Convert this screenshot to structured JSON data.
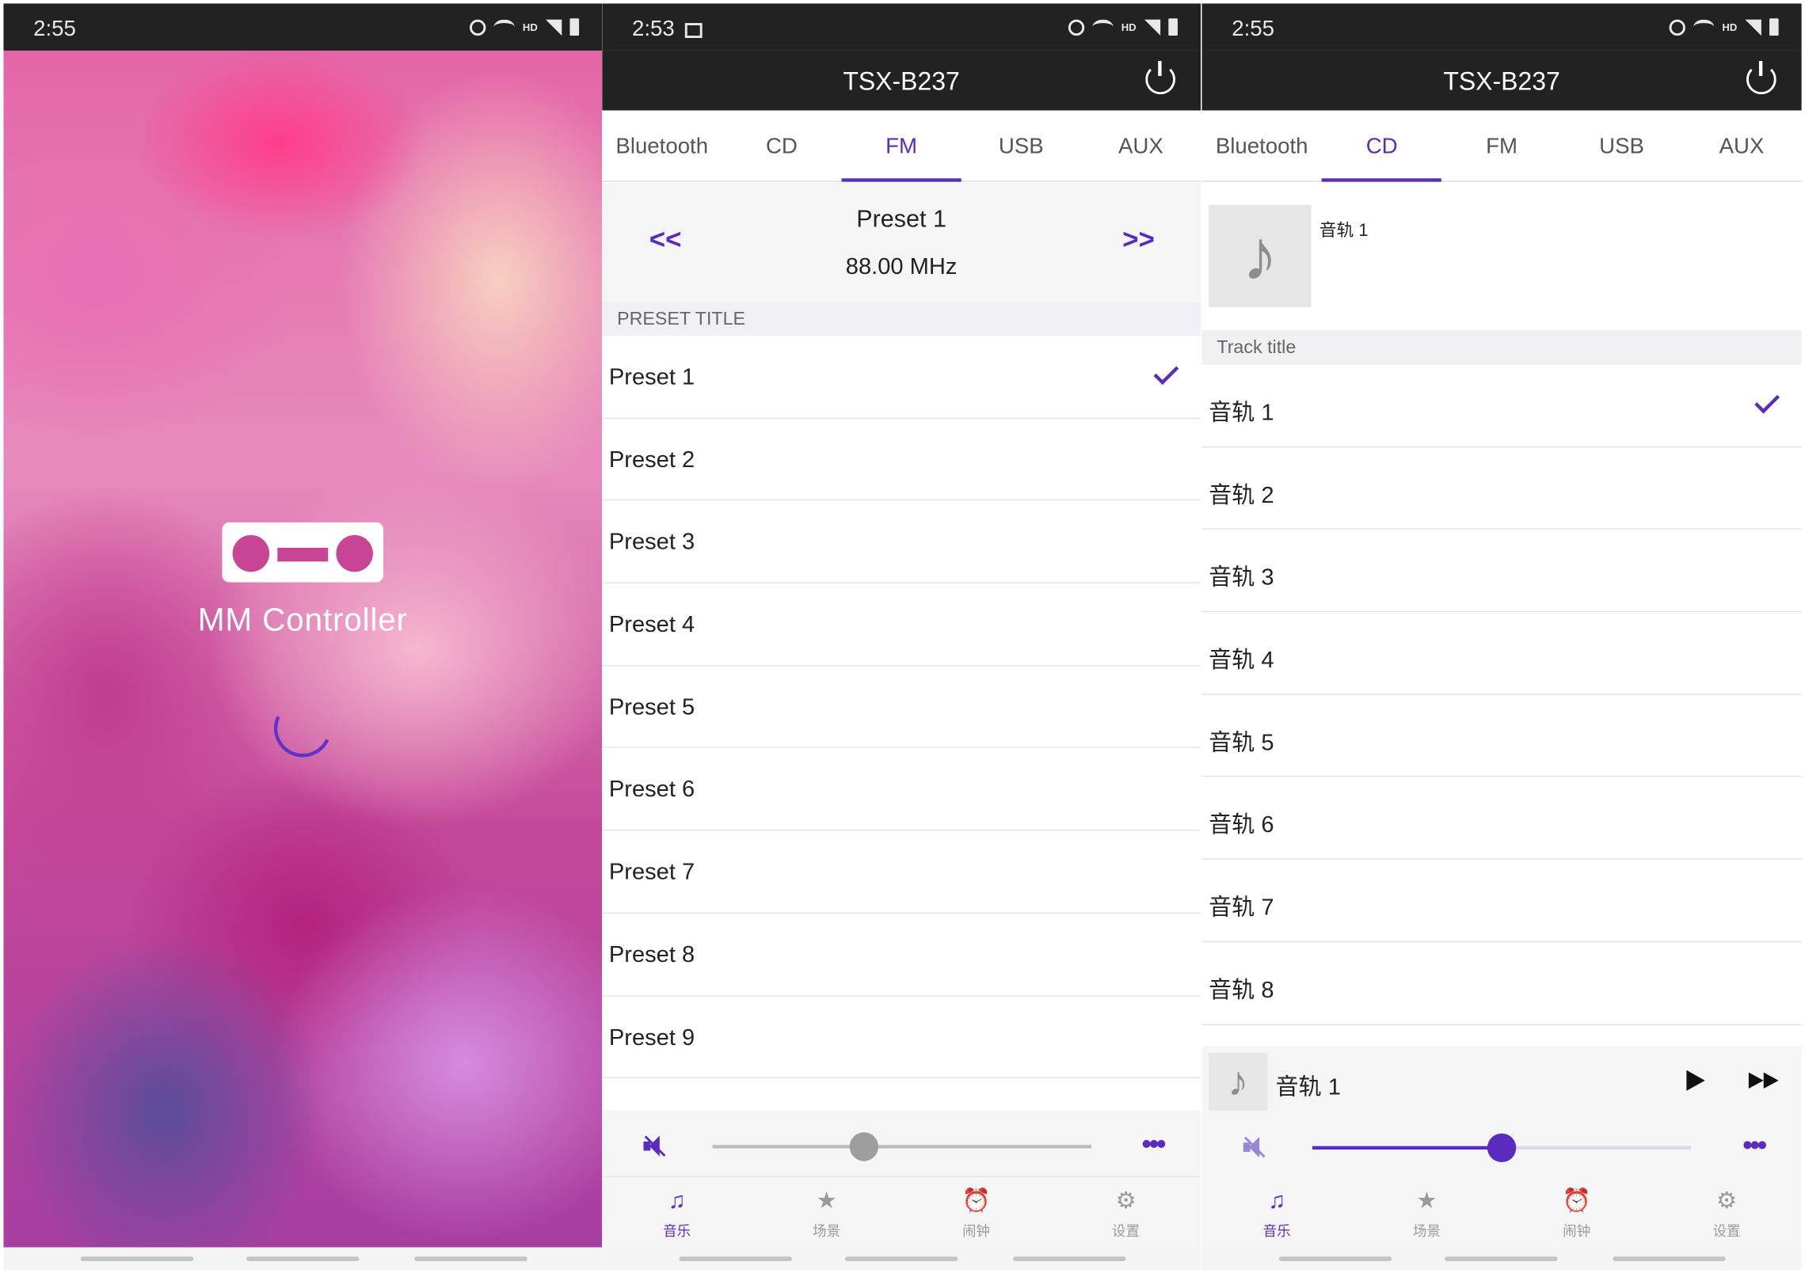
{
  "splash": {
    "time": "2:55",
    "app_name": "MM Controller"
  },
  "fm_screen": {
    "time": "2:53",
    "device_title": "TSX-B237",
    "tabs": [
      {
        "label": "Bluetooth",
        "active": false
      },
      {
        "label": "CD",
        "active": false
      },
      {
        "label": "FM",
        "active": true
      },
      {
        "label": "USB",
        "active": false
      },
      {
        "label": "AUX",
        "active": false
      }
    ],
    "prev_label": "<<",
    "next_label": ">>",
    "current_preset": "Preset 1",
    "frequency": "88.00 MHz",
    "section_title": "PRESET TITLE",
    "presets": [
      {
        "label": "Preset 1",
        "selected": true
      },
      {
        "label": "Preset 2",
        "selected": false
      },
      {
        "label": "Preset 3",
        "selected": false
      },
      {
        "label": "Preset 4",
        "selected": false
      },
      {
        "label": "Preset 5",
        "selected": false
      },
      {
        "label": "Preset 6",
        "selected": false
      },
      {
        "label": "Preset 7",
        "selected": false
      },
      {
        "label": "Preset 8",
        "selected": false
      },
      {
        "label": "Preset 9",
        "selected": false
      }
    ],
    "volume_level": 0.4,
    "bottom_nav": [
      {
        "label": "音乐",
        "icon": "music-note-icon",
        "active": true
      },
      {
        "label": "场景",
        "icon": "star-icon",
        "active": false
      },
      {
        "label": "闹钟",
        "icon": "alarm-clock-icon",
        "active": false
      },
      {
        "label": "设置",
        "icon": "gear-icon",
        "active": false
      }
    ]
  },
  "cd_screen": {
    "time": "2:55",
    "device_title": "TSX-B237",
    "tabs": [
      {
        "label": "Bluetooth",
        "active": false
      },
      {
        "label": "CD",
        "active": true
      },
      {
        "label": "FM",
        "active": false
      },
      {
        "label": "USB",
        "active": false
      },
      {
        "label": "AUX",
        "active": false
      }
    ],
    "current_track": "音轨 1",
    "section_title": "Track title",
    "tracks": [
      {
        "label": "音轨 1",
        "selected": true
      },
      {
        "label": "音轨 2",
        "selected": false
      },
      {
        "label": "音轨 3",
        "selected": false
      },
      {
        "label": "音轨 4",
        "selected": false
      },
      {
        "label": "音轨 5",
        "selected": false
      },
      {
        "label": "音轨 6",
        "selected": false
      },
      {
        "label": "音轨 7",
        "selected": false
      },
      {
        "label": "音轨 8",
        "selected": false
      }
    ],
    "now_playing": "音轨 1",
    "volume_level": 0.5,
    "bottom_nav": [
      {
        "label": "音乐",
        "icon": "music-note-icon",
        "active": true
      },
      {
        "label": "场景",
        "icon": "star-icon",
        "active": false
      },
      {
        "label": "闹钟",
        "icon": "alarm-clock-icon",
        "active": false
      },
      {
        "label": "设置",
        "icon": "gear-icon",
        "active": false
      }
    ]
  },
  "colors": {
    "accent": "#5b2bc0",
    "header_bg": "#222222"
  }
}
